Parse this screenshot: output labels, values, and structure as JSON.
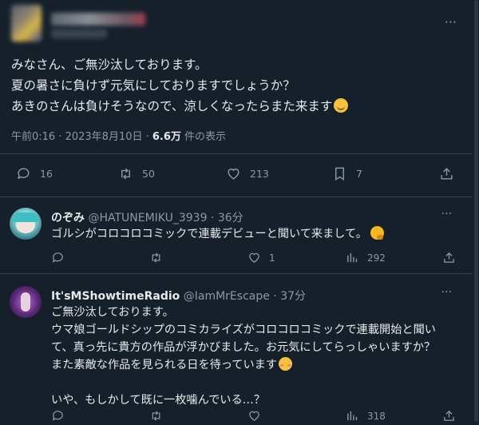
{
  "main_tweet": {
    "text_lines": [
      "みなさん、ご無沙汰しております。",
      "夏の暑さに負けず元気にしておりますでしょうか？",
      "あきのさんは負けそうなので、涼しくなったらまた来ます"
    ],
    "time": "午前0:16 · 2023年8月10日 · ",
    "views_count": "6.6万",
    "views_label": " 件の表示",
    "more_label": "···",
    "actions": {
      "replies": "16",
      "retweets": "50",
      "likes": "213",
      "bookmarks": "7"
    }
  },
  "replies": [
    {
      "name": "のぞみ",
      "handle": "@HATUNEMIKU_3939 · 36分",
      "text_lines": [
        "ゴルシがコロコロコミックで連載デビューと聞いて来まして。"
      ],
      "actions": {
        "replies": "",
        "retweets": "",
        "likes": "1",
        "views": "292"
      }
    },
    {
      "name": "It'sMShowtimeRadio",
      "handle": "@IamMrEscape · 37分",
      "text_lines": [
        "ご無沙汰しております。",
        "ウマ娘ゴールドシップのコミカライズがコロコロコミックで連載開始と聞い",
        "て、真っ先に貴方の作品が浮かびました。お元気にしてらっしゃいますか？",
        "また素敵な作品を見られる日を待っています",
        "",
        "いや、もしかして既に一枚噛んでいる…？"
      ],
      "actions": {
        "replies": "",
        "retweets": "",
        "likes": "",
        "views": "318"
      }
    }
  ],
  "colors": {
    "background": "#15202b",
    "text": "#e7e9ea",
    "muted": "#8b98a5",
    "divider": "#38444d"
  },
  "icons": [
    "reply-icon",
    "retweet-icon",
    "like-icon",
    "bookmark-icon",
    "share-icon",
    "views-icon",
    "more-icon",
    "thinking-emoji",
    "blush-emoji",
    "relieved-emoji"
  ]
}
